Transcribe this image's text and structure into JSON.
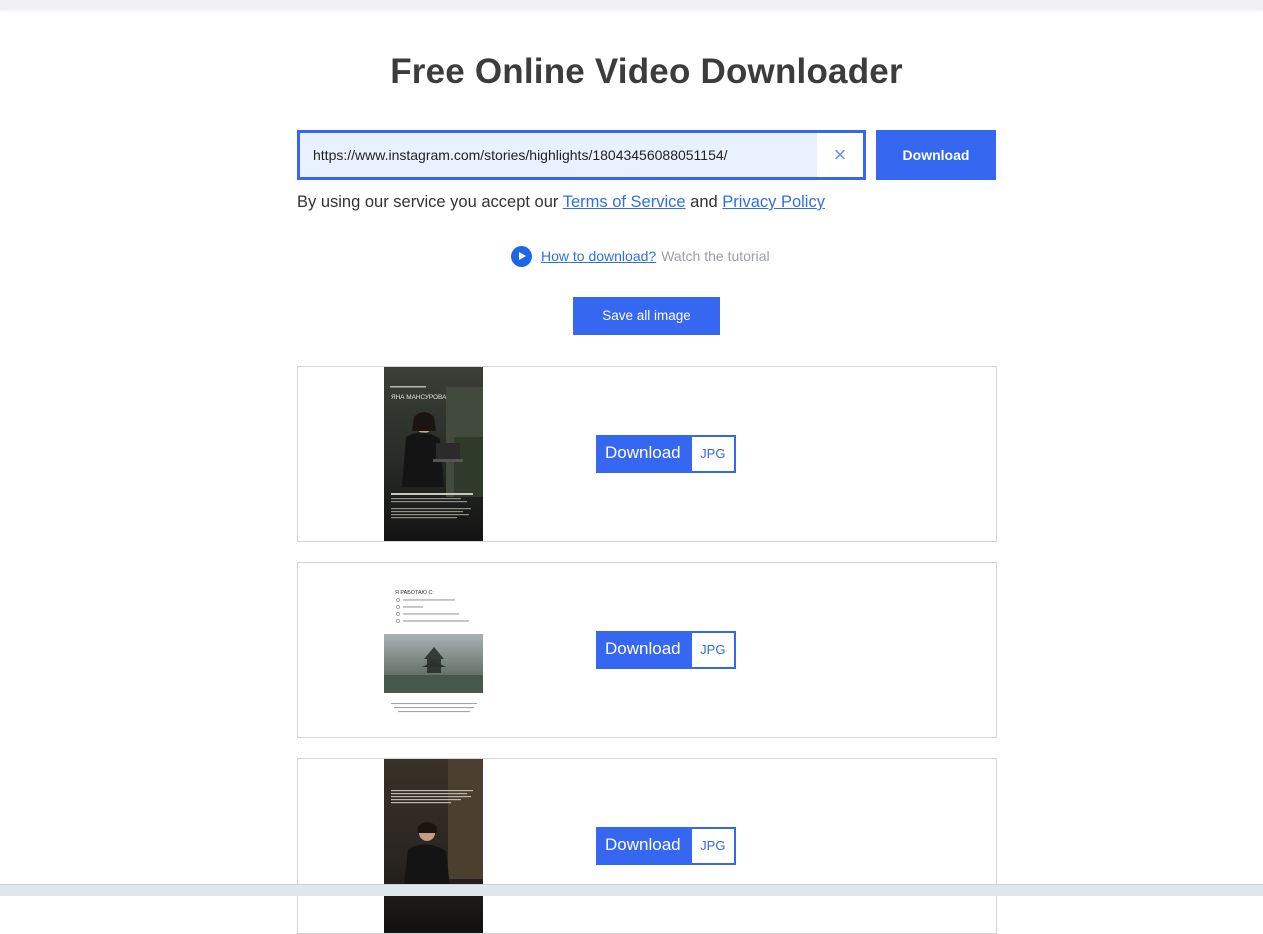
{
  "page": {
    "title": "Free Online Video Downloader"
  },
  "search": {
    "value": "https://www.instagram.com/stories/highlights/18043456088051154/",
    "clear_label": "×",
    "download_label": "Download"
  },
  "terms": {
    "prefix": "By using our service you accept our",
    "terms_link": "Terms of Service",
    "and": "and",
    "privacy_link": "Privacy Policy"
  },
  "howto": {
    "link": "How to download?",
    "sub": "Watch the tutorial"
  },
  "save_all_label": "Save all image",
  "results": [
    {
      "download_label": "Download",
      "type": "JPG",
      "thumb_name": "ЯНА МАНСУРОВА"
    },
    {
      "download_label": "Download",
      "type": "JPG",
      "thumb_heading": "Я РАБОТАЮ С:"
    },
    {
      "download_label": "Download",
      "type": "JPG"
    }
  ],
  "colors": {
    "accent": "#3567f0",
    "link": "#2f6fe4"
  }
}
